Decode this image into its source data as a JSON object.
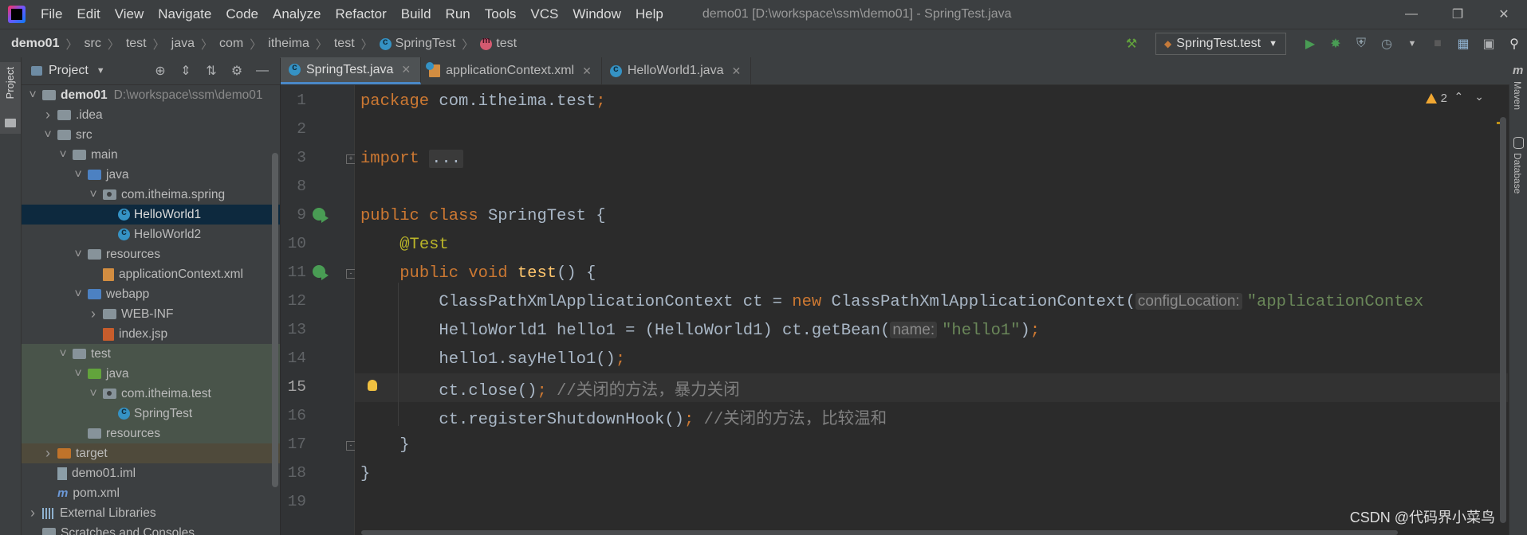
{
  "menubar": {
    "items": [
      "File",
      "Edit",
      "View",
      "Navigate",
      "Code",
      "Analyze",
      "Refactor",
      "Build",
      "Run",
      "Tools",
      "VCS",
      "Window",
      "Help"
    ],
    "title": "demo01 [D:\\workspace\\ssm\\demo01] - SpringTest.java",
    "controls": [
      "minimize-icon",
      "restore-icon",
      "close-icon"
    ]
  },
  "navbar": {
    "breadcrumbs": [
      "demo01",
      "src",
      "test",
      "java",
      "com",
      "itheima",
      "test",
      "SpringTest",
      "test"
    ],
    "run_config": "SpringTest.test",
    "icons": [
      "hammer-icon",
      "run-icon",
      "debug-icon",
      "coverage-icon",
      "profile-icon",
      "stop-icon",
      "project-structure-icon",
      "layout-icon",
      "search-icon"
    ]
  },
  "left_strip": {
    "tab_label": "Project"
  },
  "right_strip": {
    "maven_label": "Maven",
    "database_label": "Database"
  },
  "project": {
    "title": "Project",
    "tree": [
      {
        "label": "demo01",
        "path": "D:\\workspace\\ssm\\demo01",
        "kind": "module-root",
        "depth": 0,
        "expanded": true
      },
      {
        "label": ".idea",
        "kind": "folder",
        "depth": 1,
        "expanded": false
      },
      {
        "label": "src",
        "kind": "folder",
        "depth": 1,
        "expanded": true
      },
      {
        "label": "main",
        "kind": "folder",
        "depth": 2,
        "expanded": true
      },
      {
        "label": "java",
        "kind": "source-folder",
        "depth": 3,
        "expanded": true
      },
      {
        "label": "com.itheima.spring",
        "kind": "package",
        "depth": 4,
        "expanded": true
      },
      {
        "label": "HelloWorld1",
        "kind": "class",
        "depth": 5,
        "selected": true
      },
      {
        "label": "HelloWorld2",
        "kind": "class",
        "depth": 5
      },
      {
        "label": "resources",
        "kind": "resource-folder",
        "depth": 3,
        "expanded": true
      },
      {
        "label": "applicationContext.xml",
        "kind": "xml",
        "depth": 4
      },
      {
        "label": "webapp",
        "kind": "web-folder",
        "depth": 3,
        "expanded": true
      },
      {
        "label": "WEB-INF",
        "kind": "folder",
        "depth": 4,
        "expanded": false
      },
      {
        "label": "index.jsp",
        "kind": "jsp",
        "depth": 4
      },
      {
        "label": "test",
        "kind": "folder",
        "depth": 2,
        "expanded": true
      },
      {
        "label": "java",
        "kind": "test-folder",
        "depth": 3,
        "expanded": true
      },
      {
        "label": "com.itheima.test",
        "kind": "package",
        "depth": 4,
        "expanded": true
      },
      {
        "label": "SpringTest",
        "kind": "class-test",
        "depth": 5
      },
      {
        "label": "resources",
        "kind": "test-resource-folder",
        "depth": 3
      },
      {
        "label": "target",
        "kind": "excluded-folder",
        "depth": 1,
        "expanded": false
      },
      {
        "label": "demo01.iml",
        "kind": "iml",
        "depth": 1
      },
      {
        "label": "pom.xml",
        "kind": "maven",
        "depth": 1
      },
      {
        "label": "External Libraries",
        "kind": "libraries",
        "depth": 0,
        "expanded": false
      },
      {
        "label": "Scratches and Consoles",
        "kind": "scratches",
        "depth": 0
      }
    ]
  },
  "tabs": [
    {
      "label": "SpringTest.java",
      "active": true,
      "icon": "class-icon"
    },
    {
      "label": "applicationContext.xml",
      "active": false,
      "icon": "xml-icon"
    },
    {
      "label": "HelloWorld1.java",
      "active": false,
      "icon": "class-icon"
    }
  ],
  "editor": {
    "warnings_count": "2",
    "current_line": 15,
    "lines": [
      {
        "n": "1",
        "tokens": [
          {
            "t": "package ",
            "c": "kw"
          },
          {
            "t": "com.itheima.test",
            "c": ""
          },
          {
            "t": ";",
            "c": "kw"
          }
        ]
      },
      {
        "n": "2",
        "tokens": []
      },
      {
        "n": "3",
        "tokens": [
          {
            "t": "import ",
            "c": "kw"
          },
          {
            "t": "...",
            "c": "folded"
          }
        ]
      },
      {
        "n": "8",
        "tokens": []
      },
      {
        "n": "9",
        "tokens": [
          {
            "t": "public class ",
            "c": "kw"
          },
          {
            "t": "SpringTest {",
            "c": ""
          }
        ]
      },
      {
        "n": "10",
        "tokens": [
          {
            "t": "    ",
            "c": ""
          },
          {
            "t": "@Test",
            "c": "ann"
          }
        ]
      },
      {
        "n": "11",
        "tokens": [
          {
            "t": "    ",
            "c": ""
          },
          {
            "t": "public void ",
            "c": "kw"
          },
          {
            "t": "test",
            "c": "fn"
          },
          {
            "t": "() {",
            "c": ""
          }
        ]
      },
      {
        "n": "12",
        "tokens": [
          {
            "t": "        ClassPathXmlApplicationContext ct = ",
            "c": ""
          },
          {
            "t": "new ",
            "c": "kw"
          },
          {
            "t": "ClassPathXmlApplicationContext(",
            "c": ""
          },
          {
            "t": "configLocation:",
            "c": "hint"
          },
          {
            "t": "\"applicationContex",
            "c": "str"
          }
        ]
      },
      {
        "n": "13",
        "tokens": [
          {
            "t": "        HelloWorld1 hello1 = (HelloWorld1) ct.getBean(",
            "c": ""
          },
          {
            "t": "name:",
            "c": "hint"
          },
          {
            "t": "\"hello1\"",
            "c": "str"
          },
          {
            "t": ")",
            "c": ""
          },
          {
            "t": ";",
            "c": "kw"
          }
        ]
      },
      {
        "n": "14",
        "tokens": [
          {
            "t": "        hello1.sayHello1()",
            "c": ""
          },
          {
            "t": ";",
            "c": "kw"
          }
        ]
      },
      {
        "n": "15",
        "tokens": [
          {
            "t": "        ct.close()",
            "c": ""
          },
          {
            "t": "; ",
            "c": "kw"
          },
          {
            "t": "//关闭的方法，暴力关闭",
            "c": "cm"
          }
        ]
      },
      {
        "n": "16",
        "tokens": [
          {
            "t": "        ct.registerShutdownHook()",
            "c": ""
          },
          {
            "t": "; ",
            "c": "kw"
          },
          {
            "t": "//关闭的方法，比较温和",
            "c": "cm"
          }
        ]
      },
      {
        "n": "17",
        "tokens": [
          {
            "t": "    }",
            "c": ""
          }
        ]
      },
      {
        "n": "18",
        "tokens": [
          {
            "t": "}",
            "c": ""
          }
        ]
      },
      {
        "n": "19",
        "tokens": []
      }
    ]
  },
  "watermark": "CSDN @代码界小菜鸟",
  "colors": {
    "keyword": "#cc7832",
    "annotation": "#bbb529",
    "method": "#ffc66d",
    "string": "#6a8759",
    "comment": "#808080",
    "accent": "#4a88c7",
    "selection": "#0d293e"
  }
}
